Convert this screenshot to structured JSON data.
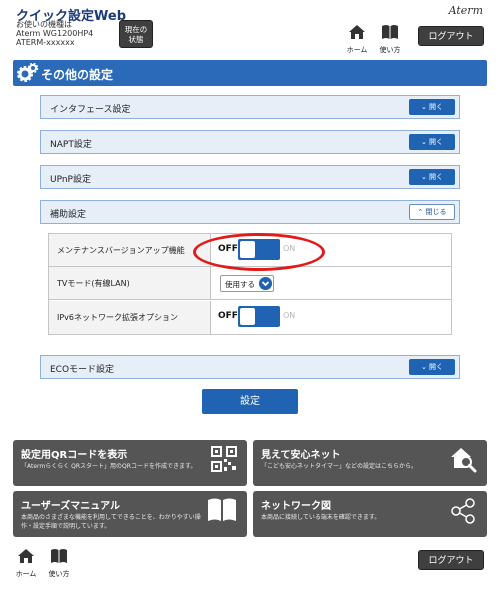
{
  "header": {
    "app_title": "クイック設定Web",
    "device_label": "お使いの機種は",
    "device_model": "Aterm WG1200HP4",
    "device_id": "ATERM-xxxxxx",
    "status_button": [
      "現在の",
      "状態"
    ],
    "home_label": "ホーム",
    "howto_label": "使い方",
    "logout_label": "ログアウト",
    "brand": "Aterm"
  },
  "section": {
    "title": "その他の設定"
  },
  "accordion": [
    {
      "label": "インタフェース設定",
      "button": "開く"
    },
    {
      "label": "NAPT設定",
      "button": "開く"
    },
    {
      "label": "UPnP設定",
      "button": "開く"
    },
    {
      "label": "補助設定",
      "button": "閉じる"
    },
    {
      "label": "ECOモード設定",
      "button": "開く"
    }
  ],
  "settings": [
    {
      "label": "メンテナンスバージョンアップ機能",
      "off": "OFF",
      "on": "ON",
      "state": "off"
    },
    {
      "label": "TVモード(有線LAN)",
      "value": "使用する"
    },
    {
      "label": "IPv6ネットワーク拡張オプション",
      "off": "OFF",
      "on": "ON",
      "state": "off"
    }
  ],
  "apply_label": "設定",
  "tiles": [
    {
      "title": "設定用QRコードを表示",
      "desc": "「Atermらくらく QRスタート」用のQRコードを作成できます。",
      "icon": "qr-code-icon"
    },
    {
      "title": "見えて安心ネット",
      "desc": "「こども安心ネットタイマー」などの設定はこちらから。",
      "icon": "house-search-icon"
    },
    {
      "title": "ユーザーズマニュアル",
      "desc": "本商品のさまざまな機能を利用してできることを、わかりやすい操作・設定手順で説明しています。",
      "icon": "book-icon"
    },
    {
      "title": "ネットワーク図",
      "desc": "本商品に接続している端末を確認できます。",
      "icon": "share-network-icon"
    }
  ],
  "footer": {
    "home_label": "ホーム",
    "howto_label": "使い方",
    "logout_label": "ログアウト"
  },
  "colors": {
    "accent": "#1f63b2",
    "section_bar": "#2b6ab8",
    "tile_bg": "#555555",
    "highlight": "#e21a1a"
  }
}
